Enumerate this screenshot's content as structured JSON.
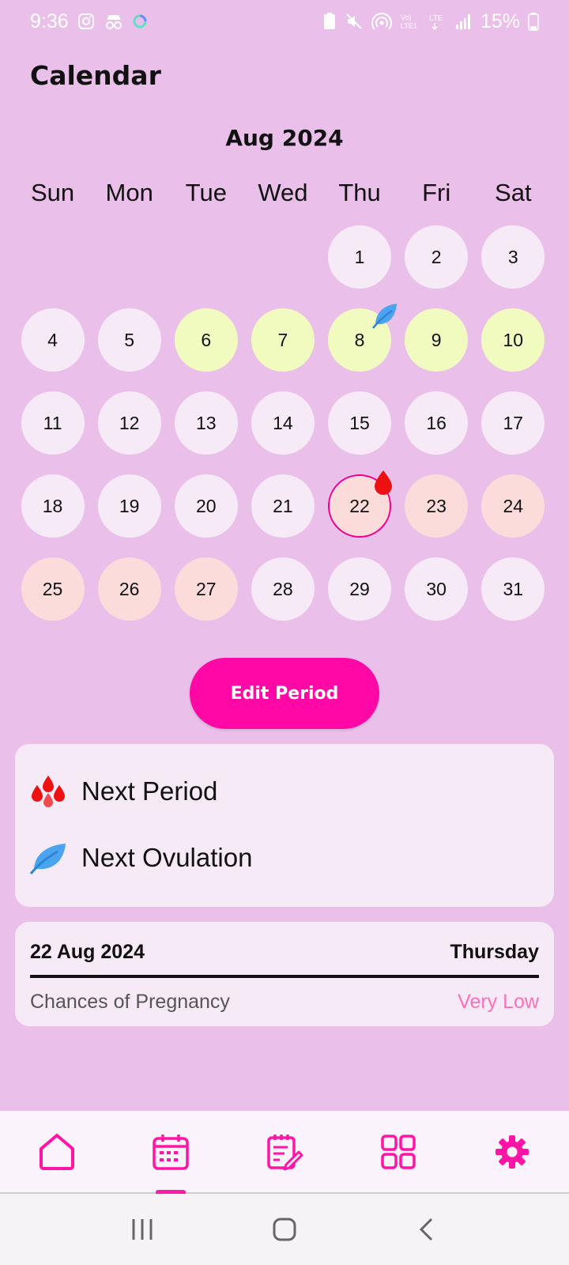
{
  "status_bar": {
    "time": "9:36",
    "battery": "15%",
    "icons_left": [
      "instagram-icon",
      "incognito-icon",
      "sync-ring-icon"
    ],
    "icons_right": [
      "battery-saver-icon",
      "mute-icon",
      "hotspot-icon",
      "volte-icon",
      "lte-icon",
      "signal-icon",
      "battery-icon"
    ]
  },
  "header": {
    "title": "Calendar"
  },
  "calendar": {
    "month_label": "Aug 2024",
    "weekdays": [
      "Sun",
      "Mon",
      "Tue",
      "Wed",
      "Thu",
      "Fri",
      "Sat"
    ],
    "first_weekday_index": 4,
    "days": [
      {
        "day": "1",
        "state": "normal"
      },
      {
        "day": "2",
        "state": "normal"
      },
      {
        "day": "3",
        "state": "normal"
      },
      {
        "day": "4",
        "state": "normal"
      },
      {
        "day": "5",
        "state": "normal"
      },
      {
        "day": "6",
        "state": "ovulation"
      },
      {
        "day": "7",
        "state": "ovulation"
      },
      {
        "day": "8",
        "state": "ovulation",
        "marker": "ovulation-leaf-icon"
      },
      {
        "day": "9",
        "state": "ovulation"
      },
      {
        "day": "10",
        "state": "ovulation"
      },
      {
        "day": "11",
        "state": "normal"
      },
      {
        "day": "12",
        "state": "normal"
      },
      {
        "day": "13",
        "state": "normal"
      },
      {
        "day": "14",
        "state": "normal"
      },
      {
        "day": "15",
        "state": "normal"
      },
      {
        "day": "16",
        "state": "normal"
      },
      {
        "day": "17",
        "state": "normal"
      },
      {
        "day": "18",
        "state": "normal"
      },
      {
        "day": "19",
        "state": "normal"
      },
      {
        "day": "20",
        "state": "normal"
      },
      {
        "day": "21",
        "state": "normal"
      },
      {
        "day": "22",
        "state": "period",
        "today": true,
        "marker": "period-drop-icon"
      },
      {
        "day": "23",
        "state": "period"
      },
      {
        "day": "24",
        "state": "period"
      },
      {
        "day": "25",
        "state": "period"
      },
      {
        "day": "26",
        "state": "period"
      },
      {
        "day": "27",
        "state": "period"
      },
      {
        "day": "28",
        "state": "normal"
      },
      {
        "day": "29",
        "state": "normal"
      },
      {
        "day": "30",
        "state": "normal"
      },
      {
        "day": "31",
        "state": "normal"
      }
    ]
  },
  "edit_button": {
    "label": "Edit Period"
  },
  "legend": {
    "items": [
      {
        "icon": "period-drops-icon",
        "label": "Next Period"
      },
      {
        "icon": "ovulation-leaf-icon",
        "label": "Next Ovulation"
      }
    ]
  },
  "info": {
    "date": "22 Aug 2024",
    "weekday": "Thursday",
    "label": "Chances of Pregnancy",
    "value": "Very Low"
  },
  "nav": {
    "items": [
      "home-icon",
      "calendar-icon",
      "notes-icon",
      "grid-icon",
      "gear-icon"
    ],
    "active_index": 1
  },
  "system_nav": [
    "recents-icon",
    "home-circle-icon",
    "back-icon"
  ],
  "colors": {
    "background": "#eac0ea",
    "accent": "#ff08a5",
    "day_normal": "#f6eaf6",
    "day_ovulation": "#f1fbbf",
    "day_period": "#fbdcdb",
    "drop_red": "#ee1111",
    "leaf_blue": "#4aa4ef",
    "pregnancy_value": "#ff6fb7"
  }
}
